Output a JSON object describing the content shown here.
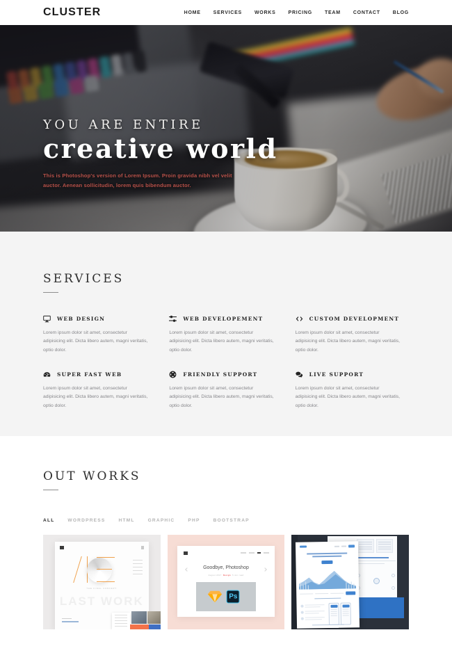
{
  "header": {
    "brand": "CLUSTER",
    "nav": [
      {
        "label": "HOME"
      },
      {
        "label": "SERVICES"
      },
      {
        "label": "WORKS"
      },
      {
        "label": "PRICING"
      },
      {
        "label": "TEAM"
      },
      {
        "label": "CONTACT"
      },
      {
        "label": "BLOG"
      }
    ]
  },
  "hero": {
    "kicker": "YOU ARE ENTIRE",
    "title": "creative world",
    "description": "This is Photoshop's version of Lorem Ipsum. Proin gravida nibh vel velit auctor. Aenean sollicitudin, lorem quis bibendum auctor.",
    "description_color": "#b9524a"
  },
  "services": {
    "heading": "SERVICES",
    "items": [
      {
        "icon": "desktop-icon",
        "title": "WEB DESIGN",
        "text": "Lorem ipsum dolor sit amet, consectetur adipisicing elit. Dicta libero autem, magni veritatis, optio dolor."
      },
      {
        "icon": "sliders-icon",
        "title": "WEB DEVELOPEMENT",
        "text": "Lorem ipsum dolor sit amet, consectetur adipisicing elit. Dicta libero autem, magni veritatis, optio dolor."
      },
      {
        "icon": "code-icon",
        "title": "CUSTOM DEVELOPMENT",
        "text": "Lorem ipsum dolor sit amet, consectetur adipisicing elit. Dicta libero autem, magni veritatis, optio dolor."
      },
      {
        "icon": "dashboard-icon",
        "title": "SUPER FAST WEB",
        "text": "Lorem ipsum dolor sit amet, consectetur adipisicing elit. Dicta libero autem, magni veritatis, optio dolor."
      },
      {
        "icon": "life-ring-icon",
        "title": "FRIENDLY SUPPORT",
        "text": "Lorem ipsum dolor sit amet, consectetur adipisicing elit. Dicta libero autem, magni veritatis, optio dolor."
      },
      {
        "icon": "comments-icon",
        "title": "LIVE SUPPORT",
        "text": "Lorem ipsum dolor sit amet, consectetur adipisicing elit. Dicta libero autem, magni veritatis, optio dolor."
      }
    ]
  },
  "works": {
    "heading": "OUT WORKS",
    "filters": [
      {
        "label": "ALL",
        "active": true
      },
      {
        "label": "WORDPRESS",
        "active": false
      },
      {
        "label": "HTML",
        "active": false
      },
      {
        "label": "GRAPHIC",
        "active": false
      },
      {
        "label": "PHP",
        "active": false
      },
      {
        "label": "BOOTSTRAP",
        "active": false
      }
    ],
    "items": [
      {
        "name": "work-thumb-last-work",
        "bigword": "LAST WORK",
        "tagline": "THE FINAL CONCEPT",
        "background": "#eceaea"
      },
      {
        "name": "work-thumb-goodbye-photoshop",
        "headline": "Goodbye, Photoshop",
        "meta_left": "August 2017",
        "meta_mid": "Design",
        "meta_right": "5 min read",
        "ps_label": "Ps",
        "background": "#f7ddd5"
      },
      {
        "name": "work-thumb-dashboard",
        "background": "#2b313b"
      }
    ]
  },
  "theme": {
    "page_background": "#ffffff",
    "services_background": "#f4f4f4",
    "text_dark": "#242424",
    "text_muted": "#86868a"
  }
}
